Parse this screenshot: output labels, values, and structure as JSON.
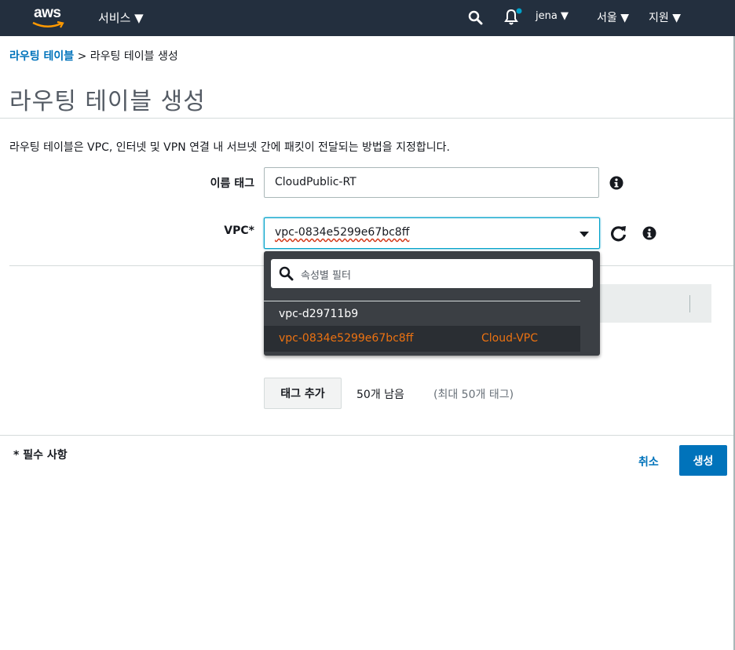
{
  "nav": {
    "logo_text": "aws",
    "services": "서비스 ▼",
    "user": "jena ▼",
    "region": "서울 ▼",
    "support": "지원 ▼",
    "icons": [
      "search-icon",
      "bell-icon"
    ]
  },
  "breadcrumb": {
    "parent": "라우팅 테이블",
    "separator": " > ",
    "current": "라우팅 테이블 생성"
  },
  "page": {
    "title": "라우팅 테이블 생성",
    "description": "라우팅 테이블은 VPC, 인터넷 및 VPN 연결 내 서브넷 간에 패킷이 전달되는 방법을 지정합니다."
  },
  "form": {
    "name_tag_label": "이름 태그",
    "name_tag_value": "CloudPublic-RT",
    "vpc_label": "VPC*",
    "vpc_value": "vpc-0834e5299e67bc8ff"
  },
  "dropdown": {
    "filter_placeholder": "속성별 필터",
    "options": [
      {
        "id": "vpc-d29711b9",
        "name": ""
      },
      {
        "id": "vpc-0834e5299e67bc8ff",
        "name": "Cloud-VPC",
        "selected": true
      }
    ]
  },
  "tags": {
    "add_button": "태그 추가",
    "remaining": "50개 남음",
    "max": "(최대 50개 태그)"
  },
  "footer": {
    "required_note": "* 필수 사항",
    "cancel": "취소",
    "create": "생성"
  },
  "colors": {
    "nav_bg": "#232f3e",
    "link": "#0073bb",
    "selected_option": "#ec7211",
    "primary_button": "#0073bb"
  }
}
